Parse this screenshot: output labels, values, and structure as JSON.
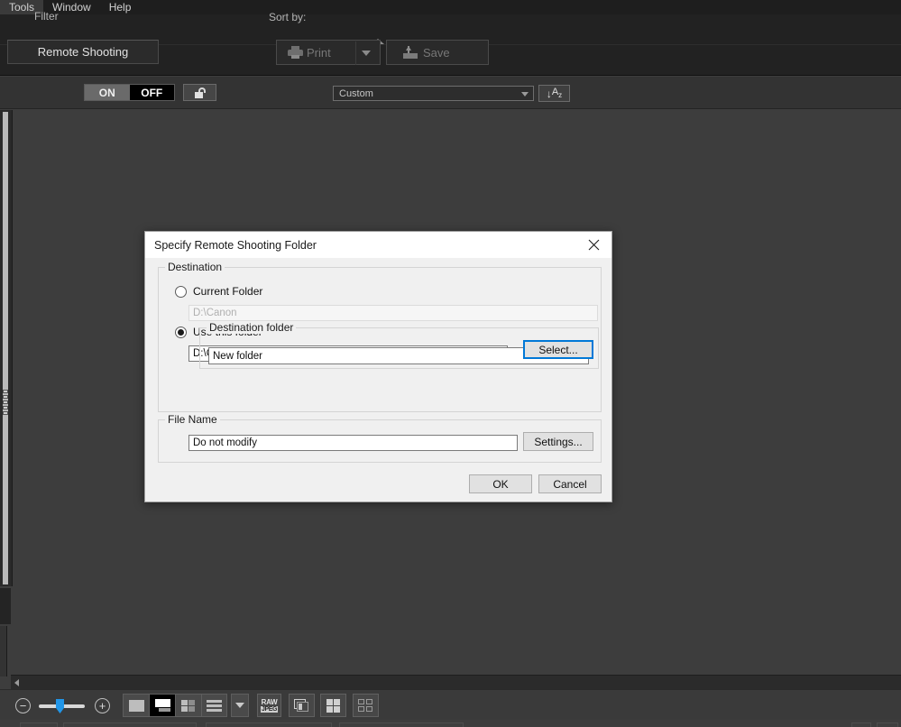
{
  "menubar": {
    "items": [
      {
        "label": "Tools"
      },
      {
        "label": "Window"
      },
      {
        "label": "Help"
      }
    ]
  },
  "toolbar": {
    "remote_shooting_label": "Remote Shooting",
    "print_label": "Print",
    "save_label": "Save",
    "collapse_icon": "triangle-up-icon"
  },
  "filterbar": {
    "filter_label": "Filter",
    "toggle_on": "ON",
    "toggle_off": "OFF",
    "toggle_state": "OFF",
    "lock_icon": "unlocked-padlock-icon",
    "sortby_label": "Sort by:",
    "sort_value": "Custom",
    "sort_options": [
      "Custom"
    ],
    "sort_direction_arrow": "↓",
    "sort_direction_label": "A",
    "sort_direction_sub": "z"
  },
  "bottombar": {
    "zoom_out_label": "−",
    "zoom_in_label": "+",
    "view_modes": [
      {
        "name": "single-image-view",
        "active": false
      },
      {
        "name": "preview-view",
        "active": true
      },
      {
        "name": "thumbnail-grid-view",
        "active": false
      },
      {
        "name": "list-view",
        "active": false
      }
    ],
    "raw_label": "RAW",
    "jpeg_label": "JPEG"
  },
  "dialog": {
    "title": "Specify Remote Shooting Folder",
    "close_icon": "close-icon",
    "destination": {
      "group_label": "Destination",
      "current_folder_label": "Current Folder",
      "current_folder_value": "D:\\Canon",
      "current_folder_selected": false,
      "use_this_folder_label": "Use this folder",
      "use_this_folder_value": "D:\\Canon\\2020\\New folder",
      "use_this_folder_selected": true,
      "select_button": "Select...",
      "destination_folder_group_label": "Destination folder",
      "destination_folder_value": "New folder"
    },
    "file_name": {
      "group_label": "File Name",
      "value": "Do not modify",
      "settings_button": "Settings..."
    },
    "ok_button": "OK",
    "cancel_button": "Cancel",
    "focus_color": "#0078d7"
  }
}
